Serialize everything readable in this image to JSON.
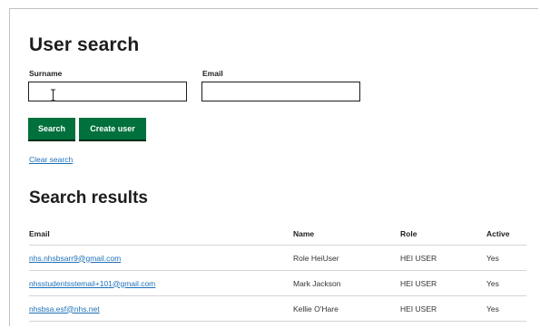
{
  "page": {
    "title": "User search"
  },
  "form": {
    "surname_label": "Surname",
    "surname_value": "",
    "email_label": "Email",
    "email_value": "",
    "search_button": "Search",
    "create_button": "Create user",
    "clear_link": "Clear search"
  },
  "results": {
    "title": "Search results",
    "headers": {
      "email": "Email",
      "name": "Name",
      "role": "Role",
      "active": "Active"
    },
    "rows": [
      {
        "email": "nhs.nhsbsarr9@gmail.com",
        "name": "Role HeiUser",
        "role": "HEI USER",
        "active": "Yes"
      },
      {
        "email": "nhsstudentsstemail+101@gmail.com",
        "name": "Mark Jackson",
        "role": "HEI USER",
        "active": "Yes"
      },
      {
        "email": "nhsbsa.esf@nhs.net",
        "name": "Kellie O'Hare",
        "role": "HEI USER",
        "active": "Yes"
      }
    ]
  },
  "icons": {
    "text_cursor": "i-beam-cursor-icon"
  },
  "colors": {
    "primary_button": "#00703c",
    "link": "#1d70b8",
    "text": "#0b0c0c"
  }
}
